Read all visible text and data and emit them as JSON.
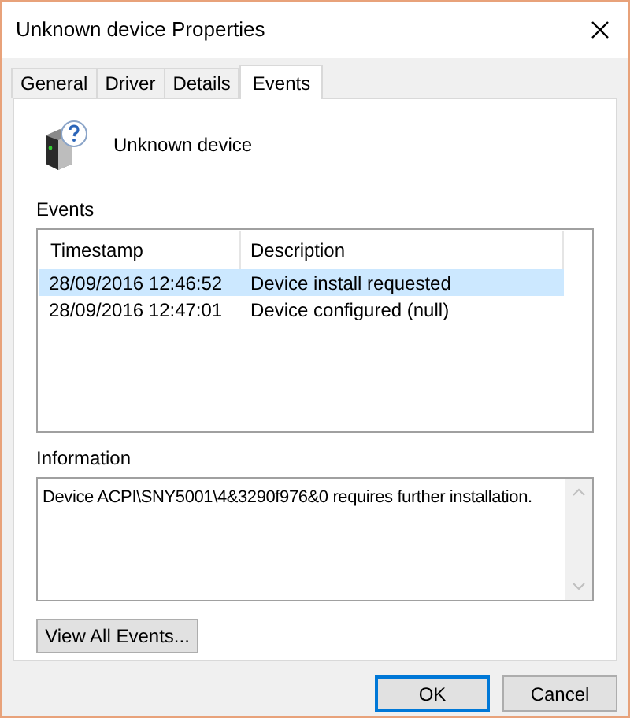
{
  "window": {
    "title": "Unknown device Properties"
  },
  "tabs": [
    {
      "label": "General",
      "selected": false
    },
    {
      "label": "Driver",
      "selected": false
    },
    {
      "label": "Details",
      "selected": false
    },
    {
      "label": "Events",
      "selected": true
    }
  ],
  "device": {
    "name": "Unknown device"
  },
  "events": {
    "label": "Events",
    "columns": [
      "Timestamp",
      "Description"
    ],
    "rows": [
      {
        "timestamp": "28/09/2016 12:46:52",
        "description": "Device install requested",
        "selected": true
      },
      {
        "timestamp": "28/09/2016 12:47:01",
        "description": "Device configured (null)",
        "selected": false
      }
    ]
  },
  "information": {
    "label": "Information",
    "value": "Device ACPI\\SNY5001\\4&3290f976&0 requires further installation."
  },
  "view_all_button": "View All Events...",
  "buttons": [
    {
      "label": "OK",
      "default": true
    },
    {
      "label": "Cancel",
      "default": false
    }
  ]
}
